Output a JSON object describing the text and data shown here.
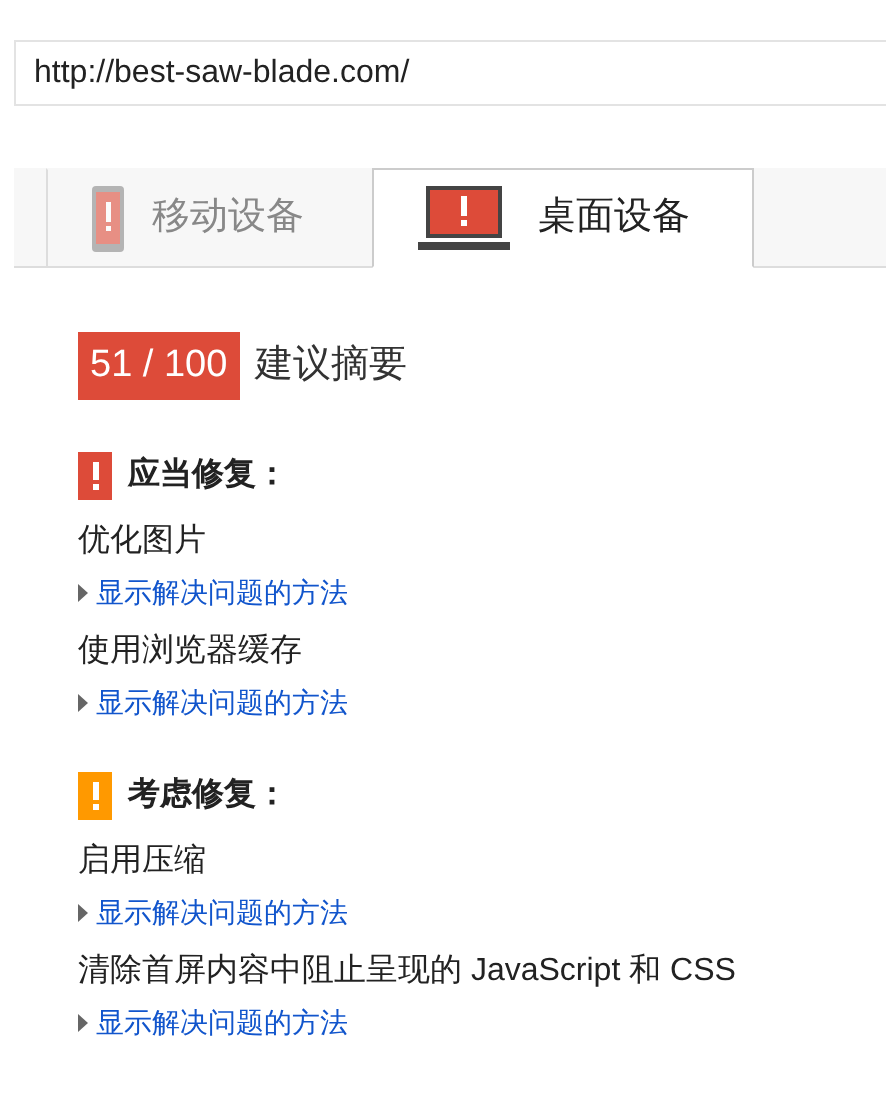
{
  "url_field": {
    "value": "http://best-saw-blade.com/"
  },
  "tabs": [
    {
      "kind": "mobile",
      "label": "移动设备",
      "selected": false
    },
    {
      "kind": "desktop",
      "label": "桌面设备",
      "selected": true
    }
  ],
  "score": {
    "value": "51 / 100",
    "title": "建议摘要"
  },
  "sections": [
    {
      "kind": "should",
      "title": "应当修复：",
      "items": [
        {
          "name": "优化图片",
          "link": "显示解决问题的方法"
        },
        {
          "name": "使用浏览器缓存",
          "link": "显示解决问题的方法"
        }
      ]
    },
    {
      "kind": "consider",
      "title": "考虑修复：",
      "items": [
        {
          "name": "启用压缩",
          "link": "显示解决问题的方法"
        },
        {
          "name": "清除首屏内容中阻止呈现的 JavaScript 和 CSS",
          "link": "显示解决问题的方法"
        }
      ]
    }
  ]
}
